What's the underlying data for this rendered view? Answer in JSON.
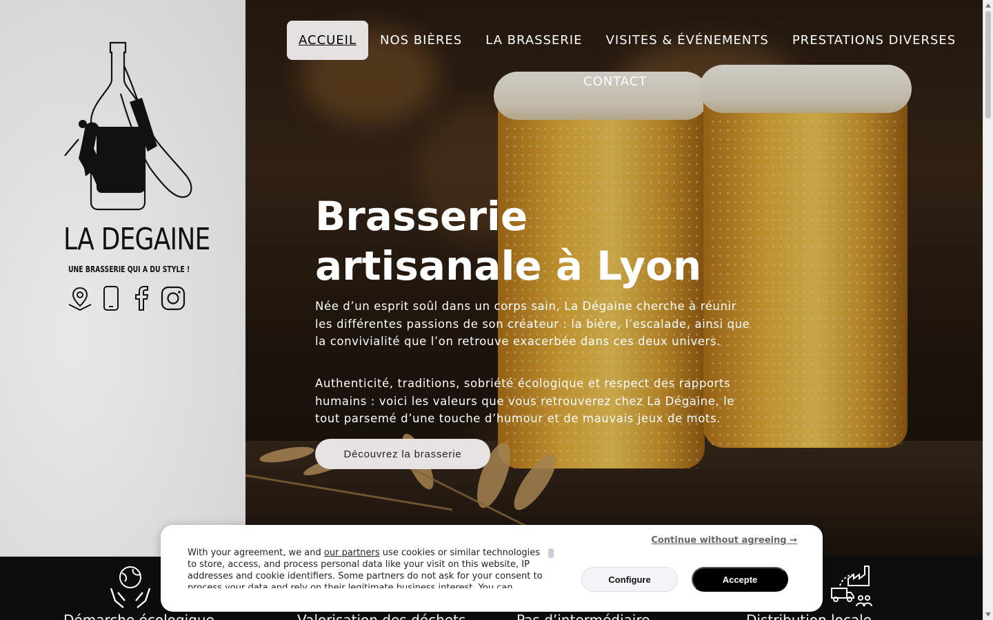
{
  "brand": {
    "name": "LA DEGAINE",
    "tagline": "UNE BRASSERIE QUI A DU STYLE !"
  },
  "social": [
    "location-pin-icon",
    "phone-icon",
    "facebook-icon",
    "instagram-icon"
  ],
  "nav": {
    "items": [
      {
        "label": "ACCUEIL",
        "active": true
      },
      {
        "label": "NOS BIÈRES"
      },
      {
        "label": "LA BRASSERIE"
      },
      {
        "label": "VISITES & ÉVÉNEMENTS"
      },
      {
        "label": "PRESTATIONS DIVERSES"
      },
      {
        "label": "CONTACT"
      }
    ]
  },
  "hero": {
    "title": "Brasserie artisanale à Lyon",
    "paragraph1": "Née d’un esprit soûl dans un corps sain, La Dégaine cherche à réunir les différentes passions de son créateur : la bière, l’escalade, ainsi que la convivialité que l’on retrouve exacerbée dans ces deux univers.",
    "paragraph2": "Authenticité, traditions, sobriété écologique et respect des rapports humains : voici les valeurs que vous retrouverez chez La Dégaine, le tout parsemé d’une touche d’humour et de mauvais jeux de mots.",
    "cta": "Découvrez la brasserie"
  },
  "features": [
    {
      "icon": "globe-hands-icon",
      "label": "Démarche écologique"
    },
    {
      "icon": "recycle-icon",
      "label": "Valorisation des déchets"
    },
    {
      "icon": "chain-icon",
      "label": "Pas d’intermédiaire"
    },
    {
      "icon": "delivery-factory-icon",
      "label": "Distribution locale"
    }
  ],
  "cookie": {
    "text_before_link": "With your agreement, we and ",
    "link": "our partners",
    "text_after_link": " use cookies or similar technologies to store, access, and process personal data like your visit on this website, IP addresses and cookie identifiers. Some partners do not ask for your consent to process your data and rely on their legitimate business interest. You can",
    "continue": "Continue without agreeing →",
    "configure": "Configure",
    "accept": "Accepte"
  },
  "colors": {
    "sidebar": "#dcdcdc",
    "band": "#0d0d0d",
    "active_nav_bg": "#e6e1e1",
    "cta_bg": "#e8e3e3"
  }
}
